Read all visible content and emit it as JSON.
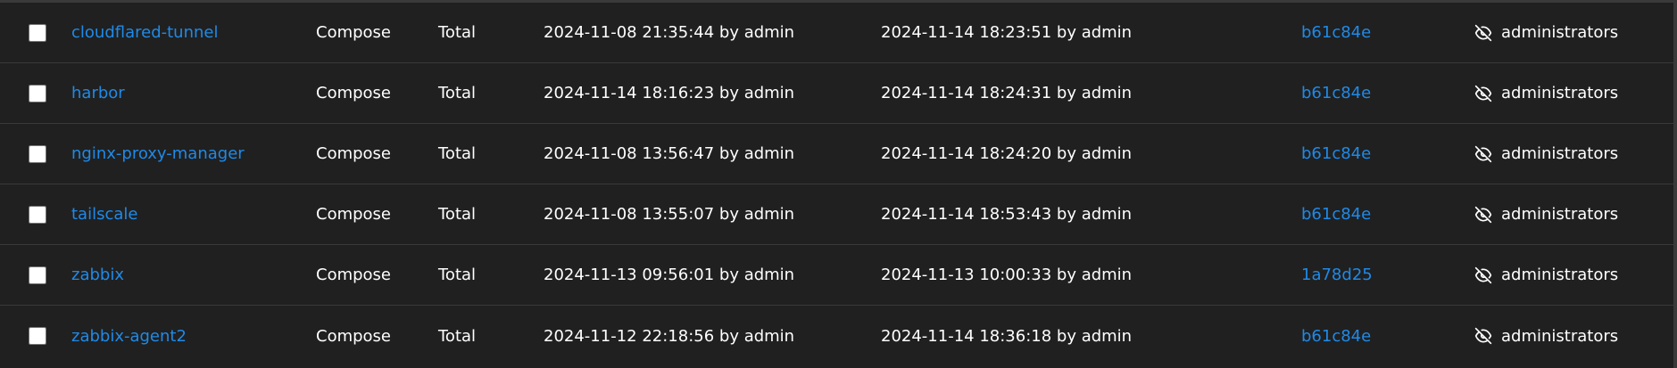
{
  "stacks": [
    {
      "name": "cloudflared-tunnel",
      "type": "Compose",
      "control": "Total",
      "created": "2024-11-08 21:35:44 by admin",
      "updated": "2024-11-14 18:23:51 by admin",
      "commit": "b61c84e",
      "ownership": "administrators"
    },
    {
      "name": "harbor",
      "type": "Compose",
      "control": "Total",
      "created": "2024-11-14 18:16:23 by admin",
      "updated": "2024-11-14 18:24:31 by admin",
      "commit": "b61c84e",
      "ownership": "administrators"
    },
    {
      "name": "nginx-proxy-manager",
      "type": "Compose",
      "control": "Total",
      "created": "2024-11-08 13:56:47 by admin",
      "updated": "2024-11-14 18:24:20 by admin",
      "commit": "b61c84e",
      "ownership": "administrators"
    },
    {
      "name": "tailscale",
      "type": "Compose",
      "control": "Total",
      "created": "2024-11-08 13:55:07 by admin",
      "updated": "2024-11-14 18:53:43 by admin",
      "commit": "b61c84e",
      "ownership": "administrators"
    },
    {
      "name": "zabbix",
      "type": "Compose",
      "control": "Total",
      "created": "2024-11-13 09:56:01 by admin",
      "updated": "2024-11-13 10:00:33 by admin",
      "commit": "1a78d25",
      "ownership": "administrators"
    },
    {
      "name": "zabbix-agent2",
      "type": "Compose",
      "control": "Total",
      "created": "2024-11-12 22:18:56 by admin",
      "updated": "2024-11-14 18:36:18 by admin",
      "commit": "b61c84e",
      "ownership": "administrators"
    }
  ],
  "icons": {
    "ownership": "eye-off-icon"
  },
  "colors": {
    "link": "#1f8ae8",
    "background": "#202020",
    "text": "#ffffff"
  }
}
